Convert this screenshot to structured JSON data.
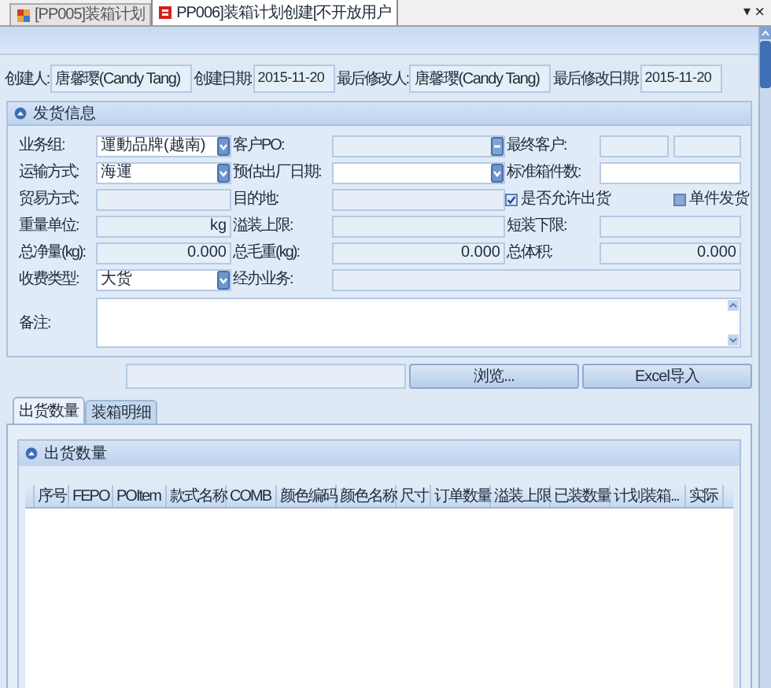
{
  "tabs": [
    {
      "label": "[PP005]装箱计划",
      "selected": false
    },
    {
      "label": "PP006]装箱计划创建[不开放用户",
      "selected": true
    }
  ],
  "tab_menu": "▾",
  "close": "×",
  "info": [
    {
      "label": "创建人:",
      "value": "唐馨璎(Candy Tang)"
    },
    {
      "label": "创建日期:",
      "value": "2015-11-20"
    },
    {
      "label": "最后修改人:",
      "value": "唐馨璎(Candy Tang)"
    },
    {
      "label": "最后修改日期:",
      "value": "2015-11-20"
    }
  ],
  "shipping": {
    "title": "发货信息",
    "columns": [
      [
        {
          "label": "业务组:",
          "kind": "combo",
          "value": "運動品牌(越南)"
        },
        {
          "label": "运输方式:",
          "kind": "combo",
          "value": "海運"
        },
        {
          "label": "贸易方式:",
          "kind": "readonly"
        },
        {
          "label": "重量单位:",
          "kind": "readonly_right",
          "value": "kg"
        },
        {
          "label": "总净量(kg):",
          "kind": "readonly_right",
          "value": "0.000"
        },
        {
          "label": "收费类型:",
          "kind": "combo",
          "value": "大货"
        }
      ],
      [
        {
          "label": "客户PO:",
          "kind": "spin"
        },
        {
          "label": "预估出厂日期:",
          "kind": "date"
        },
        {
          "label": "目的地:",
          "kind": "readonly"
        },
        {
          "label": "溢装上限:",
          "kind": "readonly"
        },
        {
          "label": "总毛重(kg):",
          "kind": "readonly_right",
          "value": "0.000"
        },
        {
          "label": "经办业务:",
          "kind": "readonly"
        }
      ],
      [
        {
          "label": "最终客户:",
          "kind": "double"
        },
        {
          "label": "标准箱件数:",
          "kind": "text"
        },
        {
          "kind": "checkboxes",
          "options": [
            {
              "label": "是否允许出货",
              "checked": true
            },
            {
              "label": "单件发货",
              "checked": false
            }
          ]
        },
        {
          "label": "短装下限:",
          "kind": "readonly"
        },
        {
          "label": "总体积:",
          "kind": "readonly_right",
          "value": "0.000"
        }
      ]
    ],
    "remark_label": "备注:"
  },
  "browse_button": "浏览...",
  "import_button": "Excel导入",
  "detail_tabs": [
    {
      "label": "出货数量",
      "selected": true
    },
    {
      "label": "装箱明细",
      "selected": false
    }
  ],
  "panel_title": "出货数量",
  "grid_columns": [
    "序号",
    "FEPO",
    "POItem",
    "款式名称",
    "COMB",
    "颜色编码",
    "颜色名称",
    "尺寸",
    "订单数量",
    "溢装上限",
    "已装数量",
    "计划装箱...",
    "实际"
  ]
}
